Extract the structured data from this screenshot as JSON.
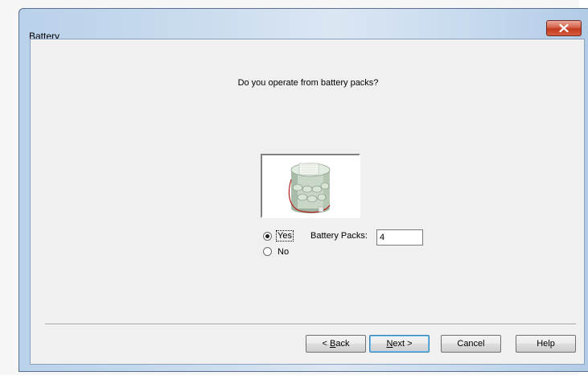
{
  "window": {
    "title": "Battery",
    "close_symbol": "✕"
  },
  "dialog": {
    "question": "Do you operate from battery packs?",
    "image_icon": "battery-pack-image",
    "options": [
      {
        "label": "Yes",
        "selected": true
      },
      {
        "label": "No",
        "selected": false
      }
    ],
    "battery_packs_label": "Battery Packs:",
    "battery_packs_value": "4"
  },
  "buttons": {
    "back_prefix": "< ",
    "back_mnemonic": "B",
    "back_rest": "ack",
    "next_mnemonic": "N",
    "next_rest": "ext >",
    "cancel": "Cancel",
    "help": "Help"
  },
  "colors": {
    "title_gradient": "#c9dbee",
    "close_button": "#c2391f",
    "client_bg": "#f0f0f0",
    "default_button_border": "#3c7fb1"
  }
}
